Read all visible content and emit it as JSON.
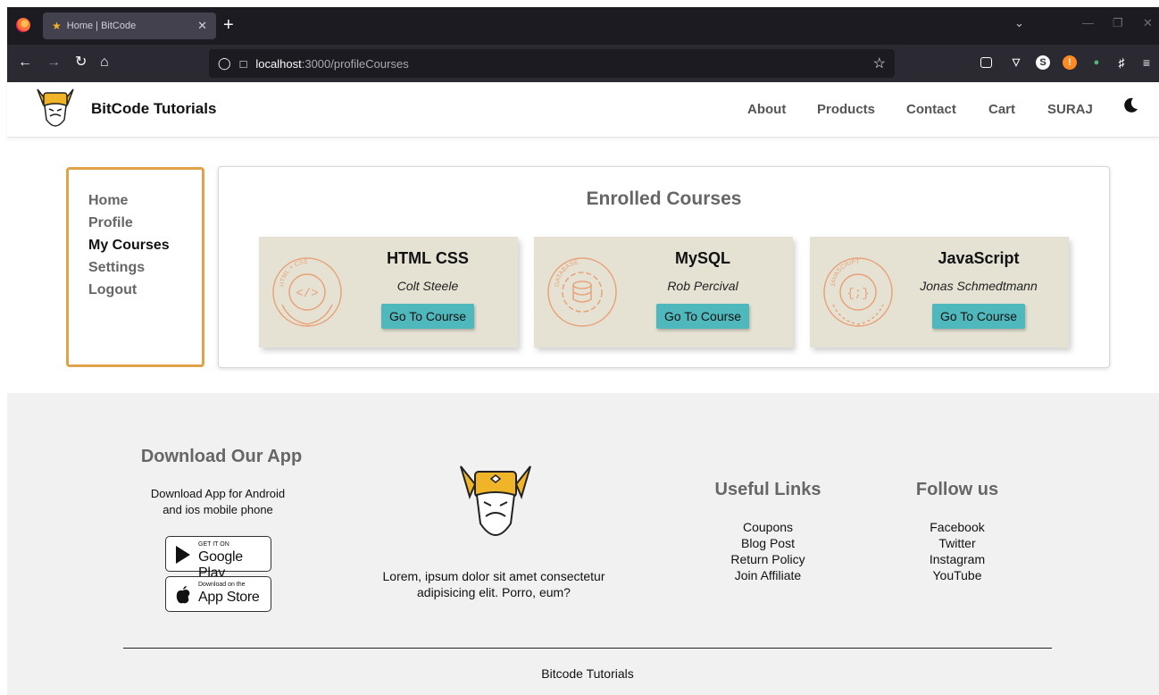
{
  "browser": {
    "tab_title": "Home | BitCode",
    "url_host": "localhost",
    "url_path": ":3000/profileCourses"
  },
  "header": {
    "brand": "BitCode Tutorials",
    "menu": [
      "About",
      "Products",
      "Contact",
      "Cart",
      "SURAJ"
    ]
  },
  "sidebar": {
    "items": [
      "Home",
      "Profile",
      "My Courses",
      "Settings",
      "Logout"
    ],
    "active": "My Courses"
  },
  "courses": {
    "title": "Enrolled Courses",
    "button_label": "Go To Course",
    "items": [
      {
        "title": "HTML CSS",
        "author": "Colt Steele",
        "emblem_text": "HTML + CSS",
        "emblem_glyph": "</>"
      },
      {
        "title": "MySQL",
        "author": "Rob Percival",
        "emblem_text": "DATABASE",
        "emblem_glyph": ""
      },
      {
        "title": "JavaScript",
        "author": "Jonas Schmedtmann",
        "emblem_text": "JAVASCRIPT",
        "emblem_glyph": "{;}"
      }
    ]
  },
  "footer": {
    "download_heading": "Download Our App",
    "download_text_1": "Download App for Android",
    "download_text_2": "and ios mobile phone",
    "google_small": "GET IT ON",
    "google_big": "Google Play",
    "apple_small": "Download on the",
    "apple_big": "App Store",
    "lorem_1": "Lorem, ipsum dolor sit amet consectetur",
    "lorem_2": "adipisicing elit. Porro, eum?",
    "useful_heading": "Useful Links",
    "useful_links": [
      "Coupons",
      "Blog Post",
      "Return Policy",
      "Join Affiliate"
    ],
    "follow_heading": "Follow us",
    "follow_links": [
      "Facebook",
      "Twitter",
      "Instagram",
      "YouTube"
    ],
    "copyright": "Bitcode Tutorials"
  },
  "colors": {
    "sidebar_border": "#e0a24a",
    "card_bg": "#e5e2d3",
    "button_bg": "#4fb8bd",
    "emblem": "#e8a27a"
  }
}
